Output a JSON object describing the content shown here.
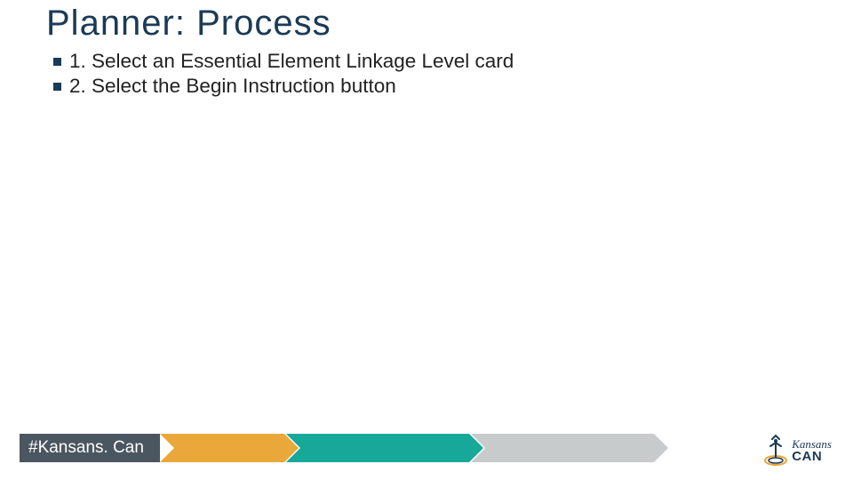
{
  "title": "Planner: Process",
  "bullets": [
    "1. Select an Essential Element Linkage Level card",
    "2. Select the Begin Instruction button"
  ],
  "hashtag": "#Kansans. Can",
  "logo": {
    "top": "Kansans",
    "bottom": "CAN"
  },
  "colors": {
    "navy": "#1b3a57",
    "gray": "#4a5660",
    "gold": "#e9a839",
    "teal": "#17a89a",
    "light_gray": "#c8cbcc"
  }
}
